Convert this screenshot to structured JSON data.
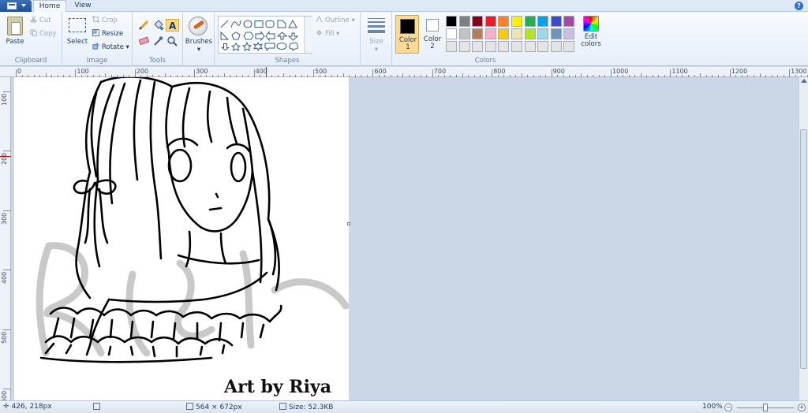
{
  "tabs": {
    "home": "Home",
    "view": "View"
  },
  "icons": {
    "file_menu": "file-menu-icon",
    "help": "help-icon",
    "paste": "clipboard-icon",
    "cut": "scissors-icon",
    "copy": "copy-icon",
    "select": "dashed-rectangle-icon",
    "crop": "crop-icon",
    "resize": "resize-icon",
    "rotate": "rotate-icon",
    "pencil": "pencil-icon",
    "fill": "paint-bucket-icon",
    "text": "text-a-icon",
    "eraser": "eraser-icon",
    "picker": "eyedropper-icon",
    "magnifier": "magnifier-icon",
    "brushes": "brush-icon",
    "outline": "outline-icon",
    "fill_shape": "fill-icon",
    "size": "line-weight-icon",
    "edit_colors": "rainbow-palette-icon"
  },
  "ribbon": {
    "clipboard": {
      "paste": "Paste",
      "cut": "Cut",
      "copy": "Copy",
      "label": "Clipboard"
    },
    "image": {
      "select": "Select",
      "crop": "Crop",
      "resize": "Resize",
      "rotate": "Rotate",
      "label": "Image"
    },
    "tools": {
      "label": "Tools"
    },
    "brushes": {
      "label": "Brushes"
    },
    "shapes": {
      "outline": "Outline",
      "fill": "Fill",
      "label": "Shapes"
    },
    "size": {
      "label": "Size"
    },
    "colors": {
      "color1": "Color 1",
      "color2": "Color 2",
      "edit": "Edit colors",
      "label": "Colors",
      "color1_value": "#000000",
      "color2_value": "#ffffff",
      "palette": [
        [
          "#000000",
          "#7f7f7f",
          "#880015",
          "#ed1c24",
          "#ff7f27",
          "#fff200",
          "#22b14c",
          "#00a2e8",
          "#3f48cc",
          "#a349a4"
        ],
        [
          "#ffffff",
          "#c3c3c3",
          "#b97a57",
          "#ffaec9",
          "#ffc90e",
          "#efe4b0",
          "#b5e61d",
          "#99d9ea",
          "#7092be",
          "#c8bfe7"
        ],
        [
          "#e4e4e4",
          "#e4e4e4",
          "#e4e4e4",
          "#e4e4e4",
          "#e4e4e4",
          "#e4e4e4",
          "#e4e4e4",
          "#e4e4e4",
          "#e4e4e4",
          "#e4e4e4"
        ]
      ]
    }
  },
  "ruler": {
    "top": [
      "0",
      "100",
      "200",
      "300",
      "400",
      "500",
      "600",
      "700",
      "800",
      "900",
      "1000",
      "1100",
      "1200",
      "1300"
    ],
    "left": [
      "100",
      "200",
      "300",
      "400",
      "500",
      "600"
    ]
  },
  "canvas": {
    "credit": "Art by Riya"
  },
  "status": {
    "cursor": "426, 218px",
    "dimensions": "564 × 672px",
    "size": "Size: 52.3KB",
    "zoom": "100%",
    "zoom_level": 0.5
  }
}
